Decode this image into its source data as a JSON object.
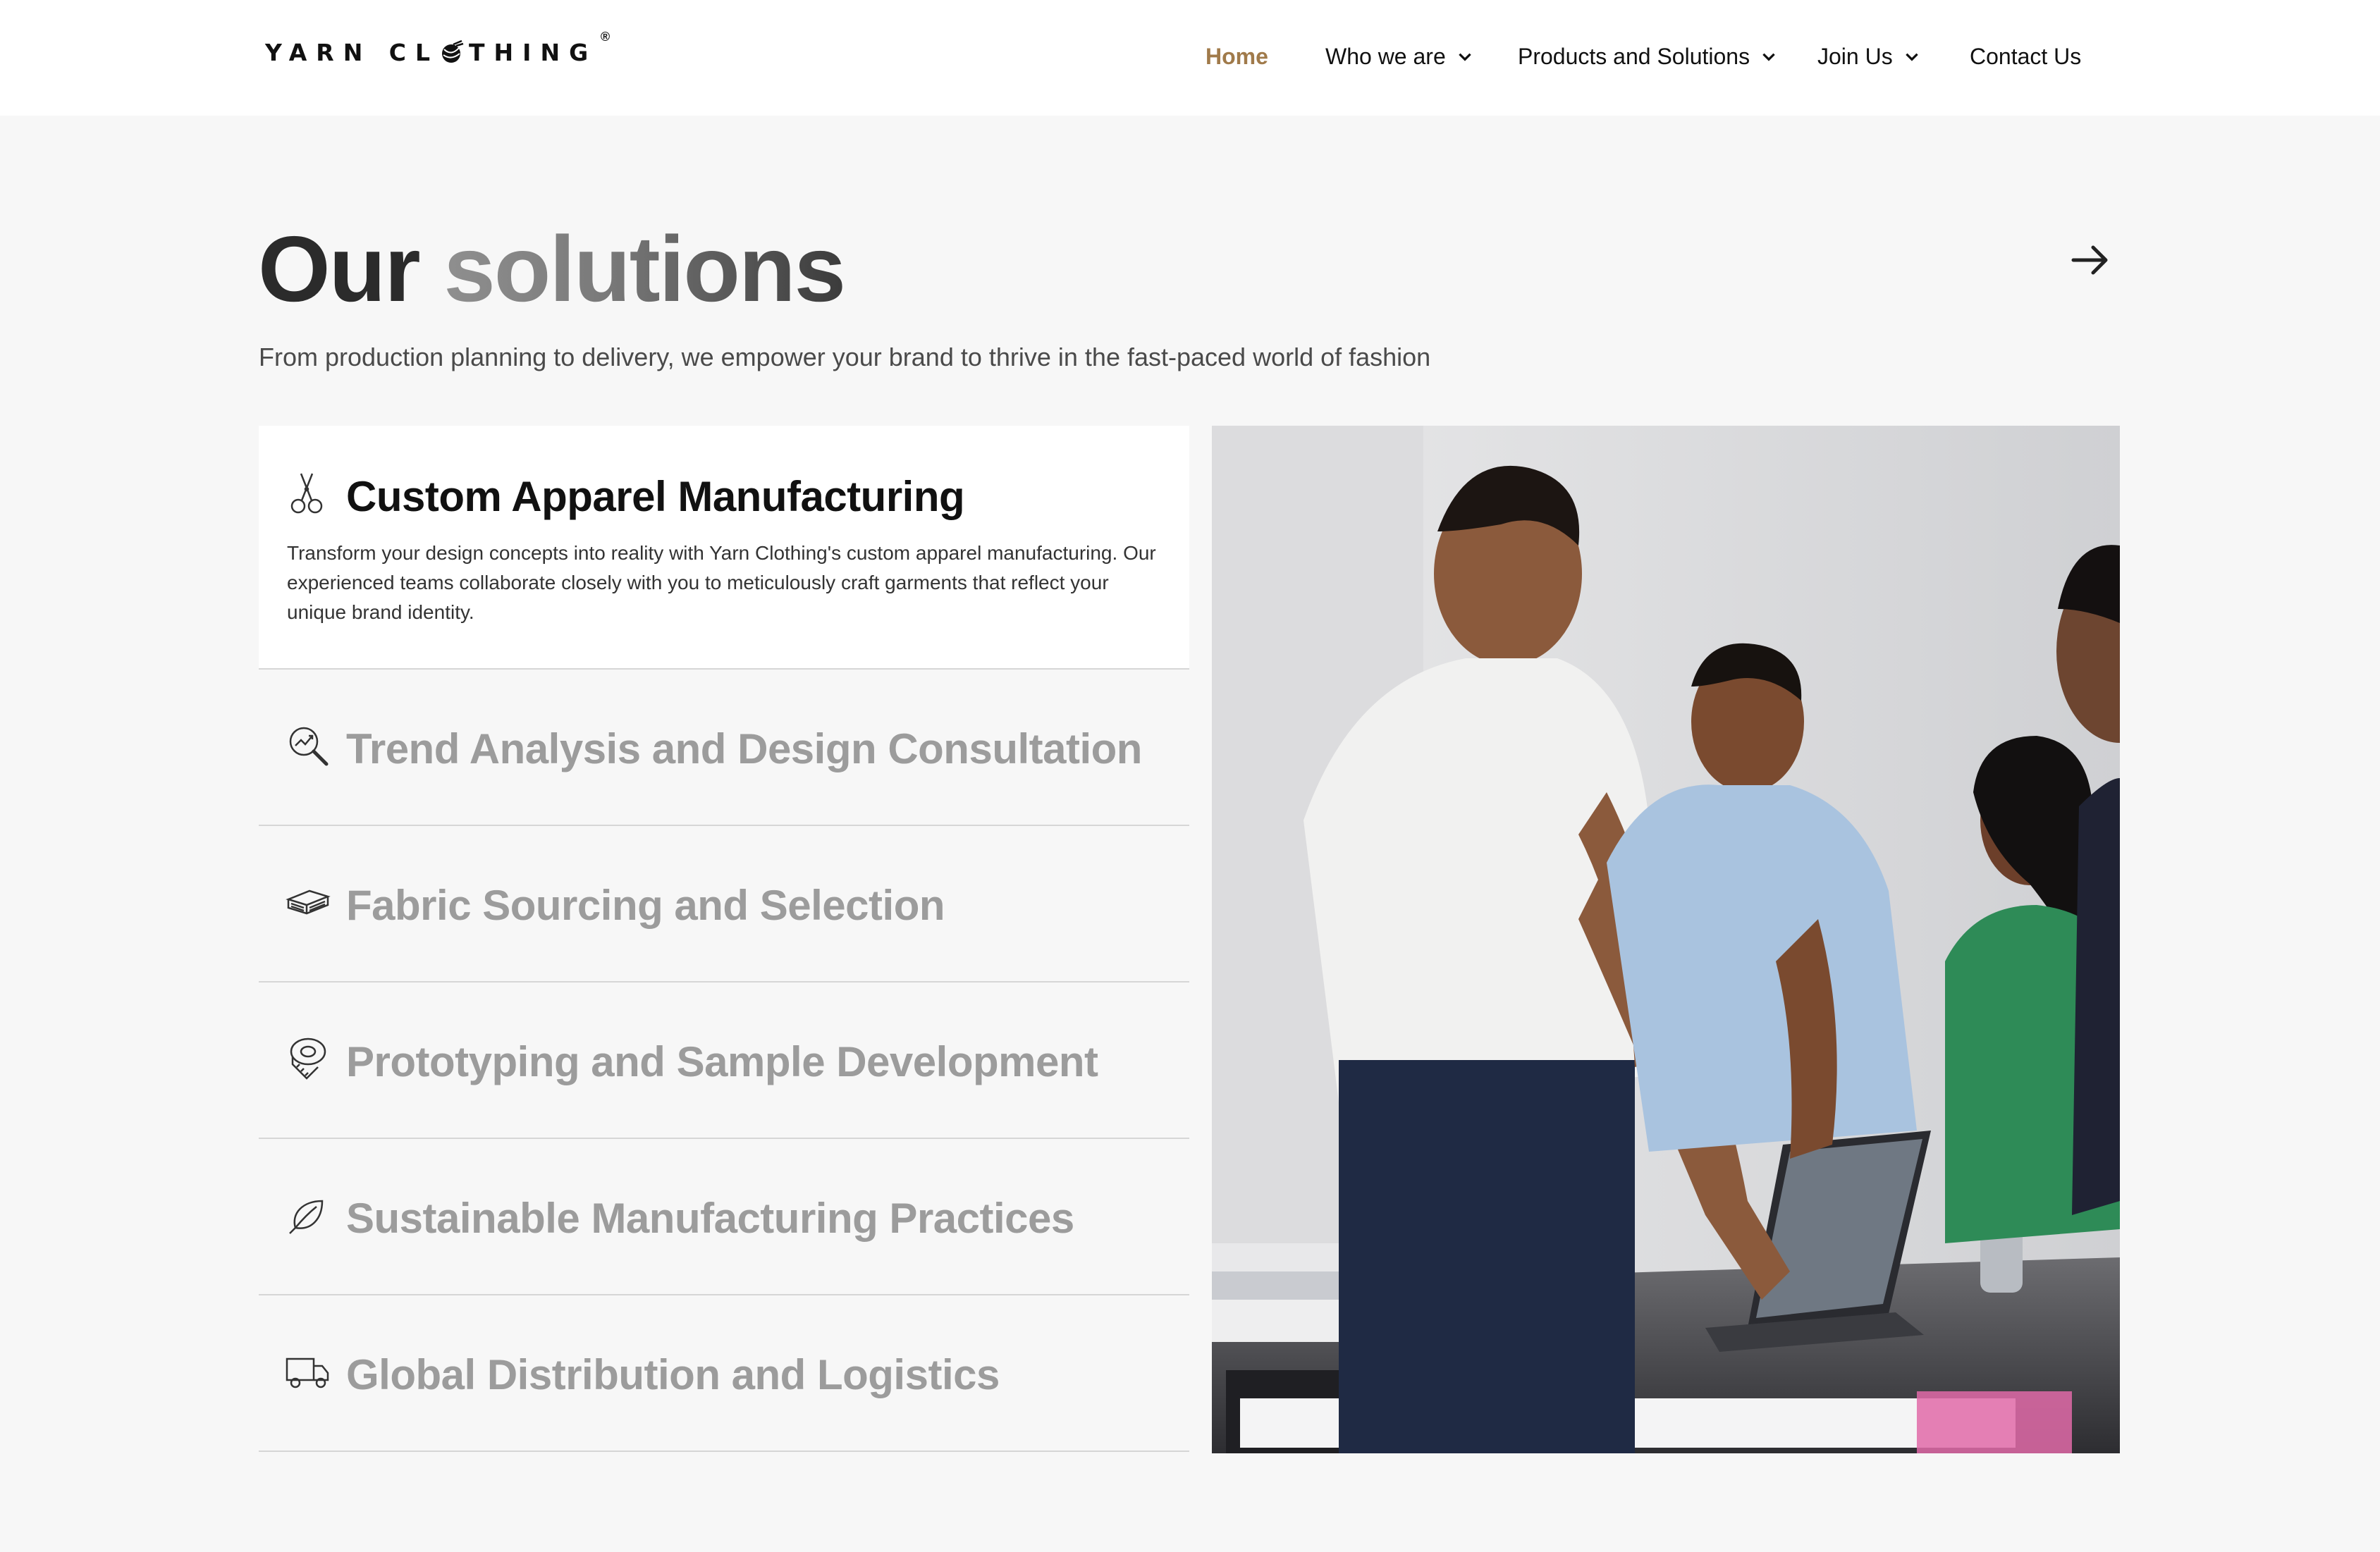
{
  "brand": {
    "logo_text_left": "YARN CL",
    "logo_text_right": "THING",
    "registered": "®"
  },
  "nav": {
    "home": "Home",
    "who": "Who we are",
    "products": "Products and Solutions",
    "join": "Join Us",
    "contact": "Contact Us"
  },
  "section": {
    "title_a": "Our ",
    "title_b": "solutions",
    "subtitle": "From production planning to delivery, we empower your brand to thrive in the fast-paced world of fashion"
  },
  "solutions": [
    {
      "title": "Custom Apparel Manufacturing",
      "icon": "scissors-icon",
      "description": "Transform your design concepts into reality with Yarn Clothing's custom apparel manufacturing. Our experienced teams collaborate closely with you to meticulously craft garments that reflect your unique brand identity.",
      "active": true
    },
    {
      "title": "Trend Analysis and Design Consultation",
      "icon": "magnifier-chart-icon"
    },
    {
      "title": "Fabric Sourcing and Selection",
      "icon": "fabric-stack-icon"
    },
    {
      "title": "Prototyping and Sample Development",
      "icon": "measuring-tape-icon"
    },
    {
      "title": "Sustainable Manufacturing Practices",
      "icon": "leaf-icon"
    },
    {
      "title": "Global Distribution and Logistics",
      "icon": "truck-icon"
    }
  ],
  "colors": {
    "accent": "#a07a4a",
    "active_title": "#111111",
    "inactive_title": "#9c9c9c",
    "background": "#f7f7f7"
  }
}
